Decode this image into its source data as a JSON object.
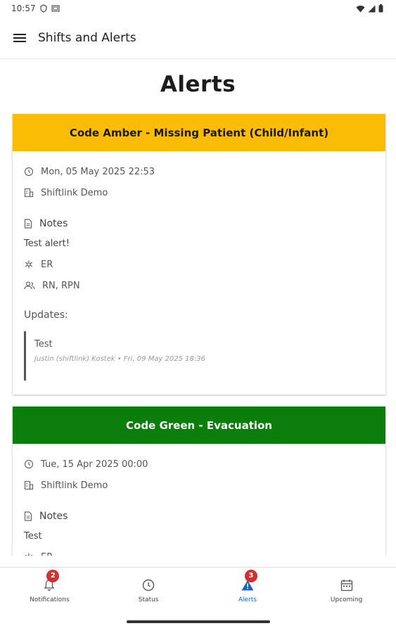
{
  "status_bar": {
    "time": "10:57"
  },
  "app_bar": {
    "title": "Shifts and Alerts",
    "menu_icon": "menu-icon"
  },
  "page": {
    "title": "Alerts"
  },
  "alerts": [
    {
      "title": "Code Amber - Missing Patient (Child/Infant)",
      "header_color": "#fbbc05",
      "header_text_color": "#1a1a1a",
      "datetime": "Mon, 05 May 2025 22:53",
      "site": "Shiftlink Demo",
      "notes_label": "Notes",
      "notes": "Test alert!",
      "department": "ER",
      "roles": "RN, RPN",
      "updates_label": "Updates:",
      "updates": [
        {
          "text": "Test",
          "meta": "Justin (shiftlink) Kostek • Fri, 09 May 2025 18:36"
        }
      ]
    },
    {
      "title": "Code Green - Evacuation",
      "header_color": "#0a7d0a",
      "header_text_color": "#ffffff",
      "datetime": "Tue, 15 Apr 2025 00:00",
      "site": "Shiftlink Demo",
      "notes_label": "Notes",
      "notes": "Test",
      "department": "ER"
    }
  ],
  "bottom_nav": [
    {
      "label": "Notifications",
      "icon": "bell-icon",
      "badge": "2",
      "active": false
    },
    {
      "label": "Status",
      "icon": "clock-icon",
      "active": false
    },
    {
      "label": "Alerts",
      "icon": "warning-icon",
      "badge": "3",
      "active": true
    },
    {
      "label": "Upcoming",
      "icon": "calendar-icon",
      "active": false
    }
  ],
  "colors": {
    "accent": "#1565c0",
    "badge": "#d32f2f"
  }
}
